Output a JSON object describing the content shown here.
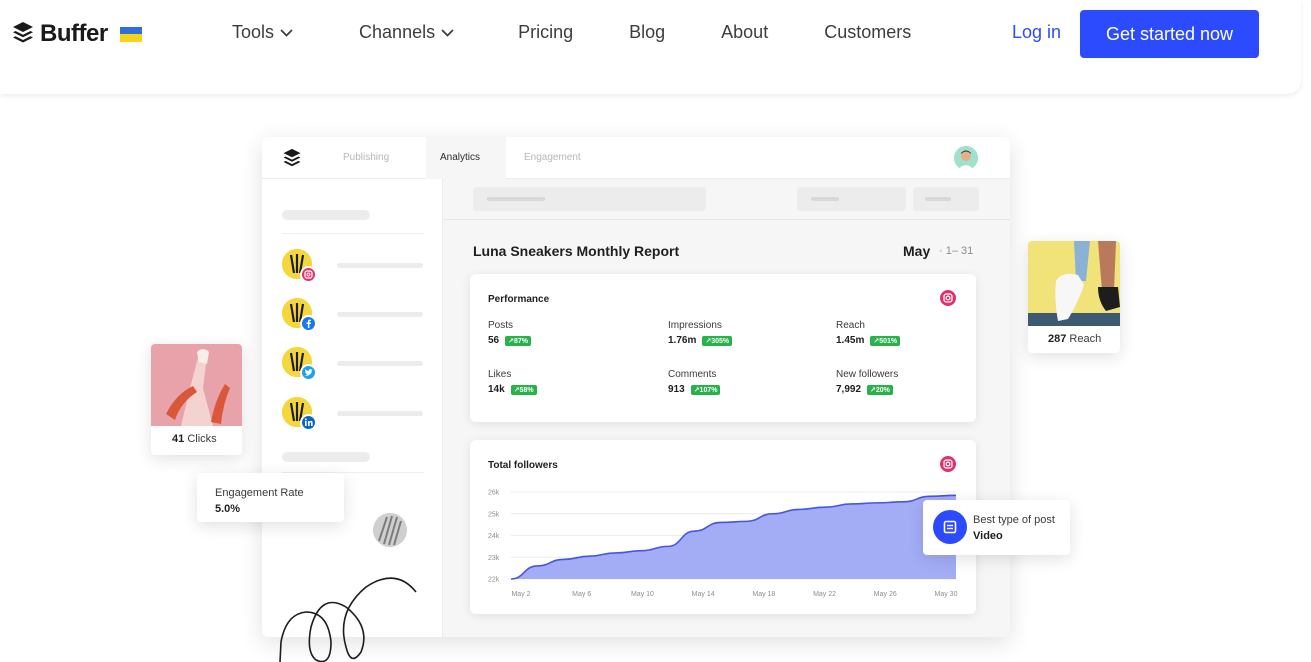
{
  "header": {
    "brand": "Buffer",
    "nav": [
      {
        "label": "Tools",
        "has_dropdown": true
      },
      {
        "label": "Channels",
        "has_dropdown": true
      },
      {
        "label": "Pricing",
        "has_dropdown": false
      },
      {
        "label": "Blog",
        "has_dropdown": false
      },
      {
        "label": "About",
        "has_dropdown": false
      },
      {
        "label": "Customers",
        "has_dropdown": false
      }
    ],
    "login": "Log in",
    "cta": "Get started now",
    "colors": {
      "accent": "#2c4bff",
      "flag_blue": "#2f6fdb",
      "flag_yellow": "#f7d319"
    }
  },
  "dashboard": {
    "tabs": [
      "Publishing",
      "Analytics",
      "Engagement"
    ],
    "active_tab": "Analytics",
    "accounts": [
      {
        "network": "instagram",
        "icon": "instagram-icon"
      },
      {
        "network": "facebook",
        "icon": "facebook-icon"
      },
      {
        "network": "twitter",
        "icon": "twitter-icon"
      },
      {
        "network": "linkedin",
        "icon": "linkedin-icon"
      }
    ],
    "report_title": "Luna Sneakers Monthly Report",
    "month": "May",
    "date_range": "1– 31",
    "performance": {
      "title": "Performance",
      "metrics": [
        {
          "label": "Posts",
          "value": "56",
          "delta": "↗87%"
        },
        {
          "label": "Impressions",
          "value": "1.76m",
          "delta": "↗305%"
        },
        {
          "label": "Reach",
          "value": "1.45m",
          "delta": "↗501%"
        },
        {
          "label": "Likes",
          "value": "14k",
          "delta": "↗58%"
        },
        {
          "label": "Comments",
          "value": "913",
          "delta": "↗107%"
        },
        {
          "label": "New followers",
          "value": "7,992",
          "delta": "↗20%"
        }
      ]
    },
    "followers_card": {
      "title": "Total followers"
    }
  },
  "chart_data": {
    "type": "area",
    "title": "Total followers",
    "x": [
      "May 2",
      "May 6",
      "May 10",
      "May 14",
      "May 18",
      "May 22",
      "May 26",
      "May 30"
    ],
    "y_ticks": [
      "22k",
      "23k",
      "24k",
      "25k",
      "26k"
    ],
    "ylim": [
      22000,
      26000
    ],
    "series": [
      {
        "values": [
          22000,
          22600,
          22900,
          23050,
          23200,
          23300,
          23500,
          24200,
          24600,
          24650,
          25000,
          25200,
          25300,
          25450,
          25500,
          25550,
          25800,
          25850
        ]
      }
    ],
    "grid": true,
    "fill_color": "#a3adf6",
    "line_color": "#4555e6"
  },
  "floating": {
    "clicks": {
      "value": "41",
      "label": "Clicks"
    },
    "reach": {
      "value": "287",
      "label": "Reach"
    },
    "engagement": {
      "label": "Engagement Rate",
      "value": "5.0%"
    },
    "best_type": {
      "label": "Best type of post",
      "value": "Video"
    }
  }
}
